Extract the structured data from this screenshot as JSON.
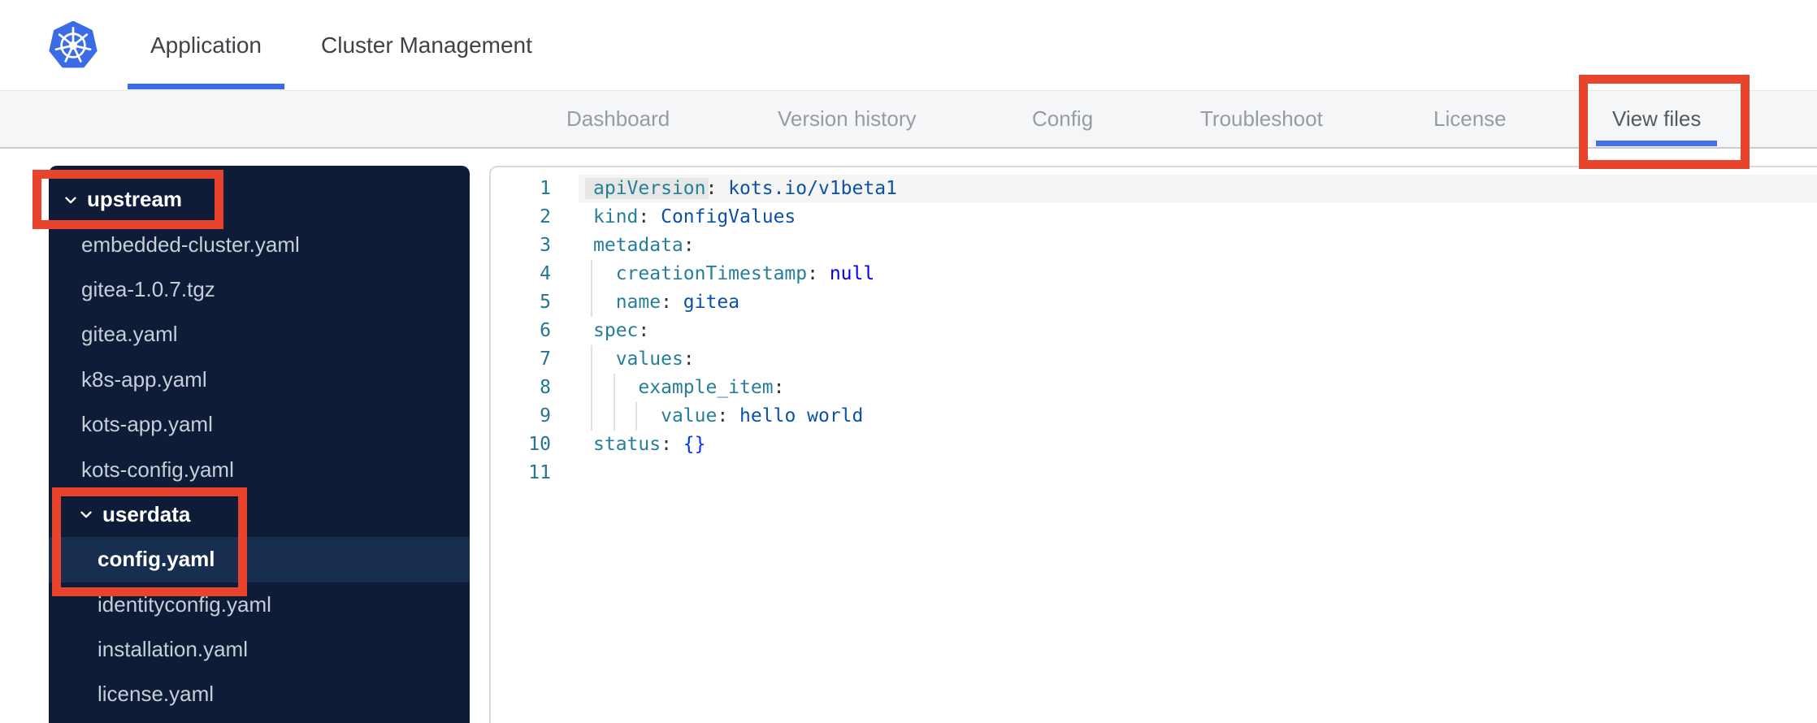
{
  "colors": {
    "accent_blue": "#3b6be6",
    "annotation_red": "#e8432c",
    "sidebar_bg": "#0e1c38",
    "sidebar_selected_bg": "#172e4f",
    "nav_bg": "#f5f6f8",
    "yaml_key": "#267f99",
    "yaml_value": "#0b51a8",
    "yaml_keyword": "#0000f0",
    "line_number": "#257693"
  },
  "header": {
    "logo_icon": "kubernetes-logo",
    "tabs": [
      {
        "label": "Application",
        "active": true
      },
      {
        "label": "Cluster Management",
        "active": false
      }
    ]
  },
  "nav": {
    "items": [
      {
        "label": "Dashboard",
        "active": false,
        "annotated": false
      },
      {
        "label": "Version history",
        "active": false,
        "annotated": false
      },
      {
        "label": "Config",
        "active": false,
        "annotated": false
      },
      {
        "label": "Troubleshoot",
        "active": false,
        "annotated": false
      },
      {
        "label": "License",
        "active": false,
        "annotated": false
      },
      {
        "label": "View files",
        "active": true,
        "annotated": true
      }
    ]
  },
  "file_tree": {
    "items": [
      {
        "type": "folder",
        "label": "upstream",
        "depth": 0,
        "expanded": true,
        "selected": false,
        "annotated": true
      },
      {
        "type": "file",
        "label": "embedded-cluster.yaml",
        "depth": 1,
        "selected": false,
        "annotated": false
      },
      {
        "type": "file",
        "label": "gitea-1.0.7.tgz",
        "depth": 1,
        "selected": false,
        "annotated": false
      },
      {
        "type": "file",
        "label": "gitea.yaml",
        "depth": 1,
        "selected": false,
        "annotated": false
      },
      {
        "type": "file",
        "label": "k8s-app.yaml",
        "depth": 1,
        "selected": false,
        "annotated": false
      },
      {
        "type": "file",
        "label": "kots-app.yaml",
        "depth": 1,
        "selected": false,
        "annotated": false
      },
      {
        "type": "file",
        "label": "kots-config.yaml",
        "depth": 1,
        "selected": false,
        "annotated": false
      },
      {
        "type": "folder",
        "label": "userdata",
        "depth": 1,
        "expanded": true,
        "selected": false,
        "annotated": true
      },
      {
        "type": "file",
        "label": "config.yaml",
        "depth": 2,
        "selected": true,
        "annotated": true
      },
      {
        "type": "file",
        "label": "identityconfig.yaml",
        "depth": 2,
        "selected": false,
        "annotated": false
      },
      {
        "type": "file",
        "label": "installation.yaml",
        "depth": 2,
        "selected": false,
        "annotated": false
      },
      {
        "type": "file",
        "label": "license.yaml",
        "depth": 2,
        "selected": false,
        "annotated": false
      }
    ]
  },
  "editor": {
    "language": "yaml",
    "lines": [
      {
        "num": 1,
        "indent": 0,
        "active": true,
        "tokens": [
          {
            "t": "key",
            "v": "apiVersion",
            "hl": true
          },
          {
            "t": "colon",
            "v": ":"
          },
          {
            "t": "val",
            "v": " kots.io/v1beta1"
          }
        ]
      },
      {
        "num": 2,
        "indent": 0,
        "tokens": [
          {
            "t": "key",
            "v": "kind"
          },
          {
            "t": "colon",
            "v": ":"
          },
          {
            "t": "val",
            "v": " ConfigValues"
          }
        ]
      },
      {
        "num": 3,
        "indent": 0,
        "tokens": [
          {
            "t": "key",
            "v": "metadata"
          },
          {
            "t": "colon",
            "v": ":"
          }
        ]
      },
      {
        "num": 4,
        "indent": 2,
        "tokens": [
          {
            "t": "key",
            "v": "creationTimestamp"
          },
          {
            "t": "colon",
            "v": ":"
          },
          {
            "t": "kw",
            "v": " null"
          }
        ]
      },
      {
        "num": 5,
        "indent": 2,
        "tokens": [
          {
            "t": "key",
            "v": "name"
          },
          {
            "t": "colon",
            "v": ":"
          },
          {
            "t": "val",
            "v": " gitea"
          }
        ]
      },
      {
        "num": 6,
        "indent": 0,
        "tokens": [
          {
            "t": "key",
            "v": "spec"
          },
          {
            "t": "colon",
            "v": ":"
          }
        ]
      },
      {
        "num": 7,
        "indent": 2,
        "tokens": [
          {
            "t": "key",
            "v": "values"
          },
          {
            "t": "colon",
            "v": ":"
          }
        ]
      },
      {
        "num": 8,
        "indent": 4,
        "tokens": [
          {
            "t": "key",
            "v": "example_item"
          },
          {
            "t": "colon",
            "v": ":"
          }
        ]
      },
      {
        "num": 9,
        "indent": 6,
        "tokens": [
          {
            "t": "key",
            "v": "value"
          },
          {
            "t": "colon",
            "v": ":"
          },
          {
            "t": "val",
            "v": " hello world"
          }
        ]
      },
      {
        "num": 10,
        "indent": 0,
        "tokens": [
          {
            "t": "key",
            "v": "status"
          },
          {
            "t": "colon",
            "v": ":"
          },
          {
            "t": "brace",
            "v": " {}"
          }
        ]
      },
      {
        "num": 11,
        "indent": 0,
        "tokens": []
      }
    ]
  },
  "annotations": {
    "boxes": [
      "upstream-folder",
      "userdata-and-config-yaml",
      "view-files-tab"
    ]
  }
}
